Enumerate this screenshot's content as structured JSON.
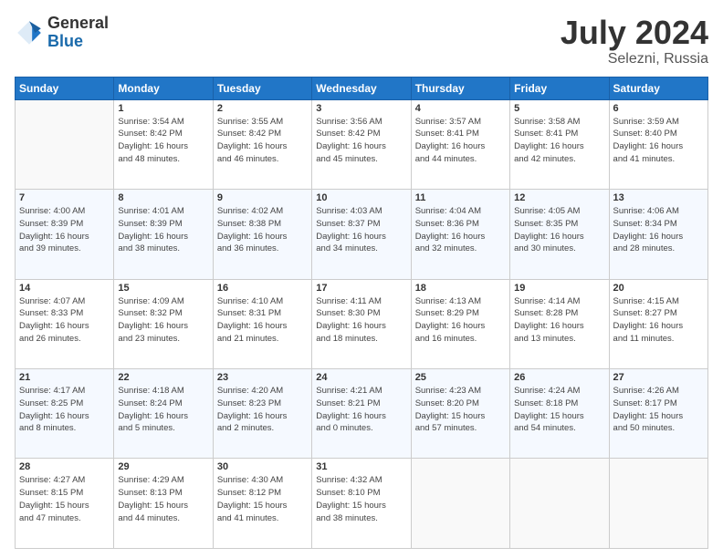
{
  "logo": {
    "general": "General",
    "blue": "Blue"
  },
  "title": {
    "month_year": "July 2024",
    "location": "Selezni, Russia"
  },
  "days_header": [
    "Sunday",
    "Monday",
    "Tuesday",
    "Wednesday",
    "Thursday",
    "Friday",
    "Saturday"
  ],
  "weeks": [
    [
      {
        "day": "",
        "info": ""
      },
      {
        "day": "1",
        "info": "Sunrise: 3:54 AM\nSunset: 8:42 PM\nDaylight: 16 hours\nand 48 minutes."
      },
      {
        "day": "2",
        "info": "Sunrise: 3:55 AM\nSunset: 8:42 PM\nDaylight: 16 hours\nand 46 minutes."
      },
      {
        "day": "3",
        "info": "Sunrise: 3:56 AM\nSunset: 8:42 PM\nDaylight: 16 hours\nand 45 minutes."
      },
      {
        "day": "4",
        "info": "Sunrise: 3:57 AM\nSunset: 8:41 PM\nDaylight: 16 hours\nand 44 minutes."
      },
      {
        "day": "5",
        "info": "Sunrise: 3:58 AM\nSunset: 8:41 PM\nDaylight: 16 hours\nand 42 minutes."
      },
      {
        "day": "6",
        "info": "Sunrise: 3:59 AM\nSunset: 8:40 PM\nDaylight: 16 hours\nand 41 minutes."
      }
    ],
    [
      {
        "day": "7",
        "info": "Sunrise: 4:00 AM\nSunset: 8:39 PM\nDaylight: 16 hours\nand 39 minutes."
      },
      {
        "day": "8",
        "info": "Sunrise: 4:01 AM\nSunset: 8:39 PM\nDaylight: 16 hours\nand 38 minutes."
      },
      {
        "day": "9",
        "info": "Sunrise: 4:02 AM\nSunset: 8:38 PM\nDaylight: 16 hours\nand 36 minutes."
      },
      {
        "day": "10",
        "info": "Sunrise: 4:03 AM\nSunset: 8:37 PM\nDaylight: 16 hours\nand 34 minutes."
      },
      {
        "day": "11",
        "info": "Sunrise: 4:04 AM\nSunset: 8:36 PM\nDaylight: 16 hours\nand 32 minutes."
      },
      {
        "day": "12",
        "info": "Sunrise: 4:05 AM\nSunset: 8:35 PM\nDaylight: 16 hours\nand 30 minutes."
      },
      {
        "day": "13",
        "info": "Sunrise: 4:06 AM\nSunset: 8:34 PM\nDaylight: 16 hours\nand 28 minutes."
      }
    ],
    [
      {
        "day": "14",
        "info": "Sunrise: 4:07 AM\nSunset: 8:33 PM\nDaylight: 16 hours\nand 26 minutes."
      },
      {
        "day": "15",
        "info": "Sunrise: 4:09 AM\nSunset: 8:32 PM\nDaylight: 16 hours\nand 23 minutes."
      },
      {
        "day": "16",
        "info": "Sunrise: 4:10 AM\nSunset: 8:31 PM\nDaylight: 16 hours\nand 21 minutes."
      },
      {
        "day": "17",
        "info": "Sunrise: 4:11 AM\nSunset: 8:30 PM\nDaylight: 16 hours\nand 18 minutes."
      },
      {
        "day": "18",
        "info": "Sunrise: 4:13 AM\nSunset: 8:29 PM\nDaylight: 16 hours\nand 16 minutes."
      },
      {
        "day": "19",
        "info": "Sunrise: 4:14 AM\nSunset: 8:28 PM\nDaylight: 16 hours\nand 13 minutes."
      },
      {
        "day": "20",
        "info": "Sunrise: 4:15 AM\nSunset: 8:27 PM\nDaylight: 16 hours\nand 11 minutes."
      }
    ],
    [
      {
        "day": "21",
        "info": "Sunrise: 4:17 AM\nSunset: 8:25 PM\nDaylight: 16 hours\nand 8 minutes."
      },
      {
        "day": "22",
        "info": "Sunrise: 4:18 AM\nSunset: 8:24 PM\nDaylight: 16 hours\nand 5 minutes."
      },
      {
        "day": "23",
        "info": "Sunrise: 4:20 AM\nSunset: 8:23 PM\nDaylight: 16 hours\nand 2 minutes."
      },
      {
        "day": "24",
        "info": "Sunrise: 4:21 AM\nSunset: 8:21 PM\nDaylight: 16 hours\nand 0 minutes."
      },
      {
        "day": "25",
        "info": "Sunrise: 4:23 AM\nSunset: 8:20 PM\nDaylight: 15 hours\nand 57 minutes."
      },
      {
        "day": "26",
        "info": "Sunrise: 4:24 AM\nSunset: 8:18 PM\nDaylight: 15 hours\nand 54 minutes."
      },
      {
        "day": "27",
        "info": "Sunrise: 4:26 AM\nSunset: 8:17 PM\nDaylight: 15 hours\nand 50 minutes."
      }
    ],
    [
      {
        "day": "28",
        "info": "Sunrise: 4:27 AM\nSunset: 8:15 PM\nDaylight: 15 hours\nand 47 minutes."
      },
      {
        "day": "29",
        "info": "Sunrise: 4:29 AM\nSunset: 8:13 PM\nDaylight: 15 hours\nand 44 minutes."
      },
      {
        "day": "30",
        "info": "Sunrise: 4:30 AM\nSunset: 8:12 PM\nDaylight: 15 hours\nand 41 minutes."
      },
      {
        "day": "31",
        "info": "Sunrise: 4:32 AM\nSunset: 8:10 PM\nDaylight: 15 hours\nand 38 minutes."
      },
      {
        "day": "",
        "info": ""
      },
      {
        "day": "",
        "info": ""
      },
      {
        "day": "",
        "info": ""
      }
    ]
  ]
}
